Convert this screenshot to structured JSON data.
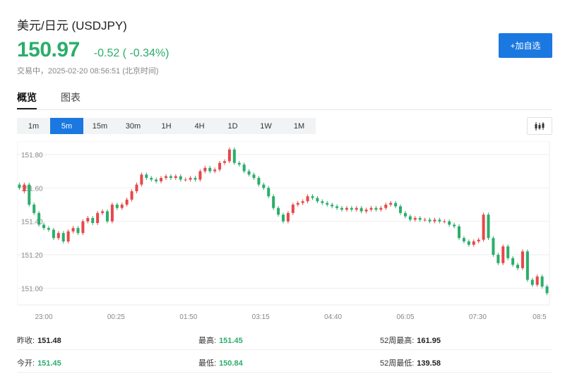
{
  "header": {
    "title": "美元/日元 (USDJPY)",
    "price": "150.97",
    "change": "-0.52 ( -0.34%)",
    "status": "交易中，2025-02-20 08:56:51 (北京时间)",
    "add_button": "+加自选"
  },
  "tabs": [
    "概览",
    "图表"
  ],
  "intervals": [
    "1m",
    "5m",
    "15m",
    "30m",
    "1H",
    "4H",
    "1D",
    "1W",
    "1M"
  ],
  "active_interval": "5m",
  "colors": {
    "up": "#e8474a",
    "down": "#2aae6b",
    "accent": "#1a78e0"
  },
  "icons": {
    "chart_type": "candlestick-icon"
  },
  "stats": {
    "prev_close_label": "昨收:",
    "prev_close": "151.48",
    "open_label": "今开:",
    "open": "151.45",
    "high_label": "最高:",
    "high": "151.45",
    "low_label": "最低:",
    "low": "150.84",
    "w52_high_label": "52周最高:",
    "w52_high": "161.95",
    "w52_low_label": "52周最低:",
    "w52_low": "139.58"
  },
  "chart_data": {
    "type": "candlestick",
    "ylim": [
      150.9,
      151.88
    ],
    "y_ticks": [
      151.0,
      151.2,
      151.4,
      151.6,
      151.8
    ],
    "y_tick_labels": [
      "151.00",
      "151.20",
      "151.40",
      "151.60",
      "151.80"
    ],
    "x_tick_labels": [
      "23:00",
      "00:25",
      "01:50",
      "03:15",
      "04:40",
      "06:05",
      "07:30",
      "08:5"
    ],
    "closes": [
      151.6,
      151.62,
      151.5,
      151.45,
      151.38,
      151.36,
      151.35,
      151.3,
      151.33,
      151.28,
      151.34,
      151.36,
      151.33,
      151.4,
      151.42,
      151.39,
      151.45,
      151.46,
      151.4,
      151.5,
      151.48,
      151.5,
      151.53,
      151.58,
      151.62,
      151.68,
      151.66,
      151.65,
      151.64,
      151.66,
      151.67,
      151.66,
      151.67,
      151.65,
      151.65,
      151.66,
      151.65,
      151.7,
      151.72,
      151.7,
      151.71,
      151.75,
      151.76,
      151.83,
      151.75,
      151.74,
      151.7,
      151.68,
      151.66,
      151.62,
      151.6,
      151.55,
      151.48,
      151.44,
      151.4,
      151.45,
      151.5,
      151.51,
      151.52,
      151.55,
      151.54,
      151.52,
      151.51,
      151.5,
      151.49,
      151.48,
      151.47,
      151.48,
      151.47,
      151.48,
      151.46,
      151.47,
      151.48,
      151.47,
      151.48,
      151.5,
      151.51,
      151.49,
      151.45,
      151.43,
      151.41,
      151.42,
      151.41,
      151.41,
      151.4,
      151.41,
      151.4,
      151.4,
      151.38,
      151.37,
      151.3,
      151.28,
      151.26,
      151.28,
      151.29,
      151.44,
      151.3,
      151.2,
      151.15,
      151.25,
      151.18,
      151.14,
      151.12,
      151.22,
      151.05,
      151.02,
      151.07,
      151.01,
      150.97
    ],
    "opens": [
      151.62,
      151.58,
      151.62,
      151.5,
      151.45,
      151.38,
      151.36,
      151.35,
      151.3,
      151.33,
      151.28,
      151.34,
      151.36,
      151.33,
      151.4,
      151.42,
      151.39,
      151.45,
      151.46,
      151.4,
      151.5,
      151.48,
      151.5,
      151.53,
      151.58,
      151.62,
      151.68,
      151.66,
      151.65,
      151.64,
      151.66,
      151.67,
      151.66,
      151.67,
      151.65,
      151.65,
      151.66,
      151.65,
      151.7,
      151.72,
      151.7,
      151.71,
      151.75,
      151.76,
      151.83,
      151.75,
      151.74,
      151.7,
      151.68,
      151.66,
      151.62,
      151.6,
      151.55,
      151.48,
      151.44,
      151.4,
      151.45,
      151.5,
      151.51,
      151.52,
      151.55,
      151.54,
      151.52,
      151.51,
      151.5,
      151.49,
      151.48,
      151.47,
      151.48,
      151.47,
      151.48,
      151.46,
      151.47,
      151.48,
      151.47,
      151.48,
      151.5,
      151.51,
      151.49,
      151.45,
      151.43,
      151.41,
      151.42,
      151.41,
      151.41,
      151.4,
      151.41,
      151.4,
      151.4,
      151.38,
      151.37,
      151.3,
      151.28,
      151.26,
      151.28,
      151.29,
      151.44,
      151.3,
      151.2,
      151.15,
      151.25,
      151.18,
      151.14,
      151.12,
      151.22,
      151.05,
      151.02,
      151.07,
      151.01
    ]
  }
}
